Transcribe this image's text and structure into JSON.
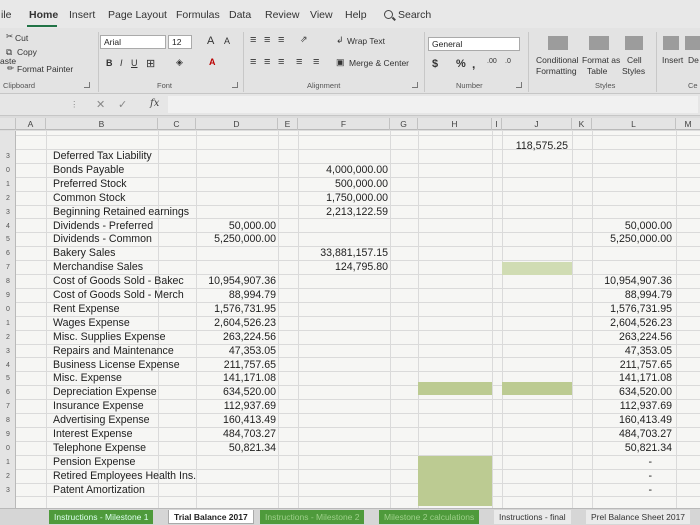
{
  "tabs": [
    "ile",
    "Home",
    "Insert",
    "Page Layout",
    "Formulas",
    "Data",
    "Review",
    "View",
    "Help",
    "Search"
  ],
  "ribbon": {
    "clipboard": {
      "cut": "Cut",
      "copy": "Copy",
      "format_painter": "Format Painter",
      "paste_fragment": "aste",
      "label": "Clipboard"
    },
    "font": {
      "name": "Arial",
      "size": "12",
      "grow": "A",
      "shrink": "A",
      "bold": "B",
      "italic": "I",
      "underline": "U",
      "label": "Font"
    },
    "alignment": {
      "wrap": "Wrap Text",
      "merge": "Merge & Center",
      "label": "Alignment"
    },
    "number": {
      "format": "General",
      "currency": "$",
      "percent": "%",
      "comma": ",",
      "label": "Number"
    },
    "styles": {
      "conditional": "Conditional",
      "formatting": "Formatting",
      "format_as": "Format as",
      "table": "Table",
      "cell": "Cell",
      "styles": "Styles",
      "label": "Styles"
    },
    "insert": "Insert",
    "delete_fragment": "De",
    "cells_fragment": "Ce"
  },
  "formula_bar": {
    "fx": "fx",
    "value": ""
  },
  "columns": [
    "A",
    "B",
    "C",
    "D",
    "E",
    "F",
    "G",
    "H",
    "I",
    "J",
    "K",
    "L",
    "M"
  ],
  "row_numbers": [
    "",
    "",
    "",
    "",
    "",
    "",
    "",
    "",
    "",
    "",
    "",
    "",
    "",
    "",
    "",
    "",
    "",
    "",
    "",
    "",
    "",
    "",
    "",
    "",
    "",
    "",
    ""
  ],
  "row_numbers_visible": [
    "3",
    "0",
    "1",
    "2",
    "3",
    "4",
    "5",
    "6",
    "7",
    "8",
    "9",
    "0",
    "1",
    "2",
    "3",
    "4",
    "5",
    "6",
    "7",
    "8",
    "9",
    "0",
    "1",
    "2",
    "3"
  ],
  "accounts": [
    "Deferred Tax Liability",
    "Bonds Payable",
    "Preferred Stock",
    "Common Stock",
    "Beginning Retained earnings",
    "Dividends - Preferred",
    "Dividends - Common",
    "Bakery Sales",
    "Merchandise Sales",
    "Cost of Goods Sold - Bakec",
    "Cost of Goods Sold - Merch",
    "Rent Expense",
    "Wages Expense",
    "Misc. Supplies Expense",
    "Repairs and Maintenance",
    "Business License Expense",
    "Misc. Expense",
    "Depreciation Expense",
    "Insurance Expense",
    "Advertising Expense",
    "Interest Expense",
    "Telephone Expense",
    "Pension Expense",
    "Retired Employees Health Ins.",
    "Patent Amortization"
  ],
  "col_d": [
    "",
    "",
    "",
    "",
    "",
    "50,000.00",
    "5,250,000.00",
    "",
    "",
    "10,954,907.36",
    "88,994.79",
    "1,576,731.95",
    "2,604,526.23",
    "263,224.56",
    "47,353.05",
    "211,757.65",
    "141,171.08",
    "634,520.00",
    "112,937.69",
    "160,413.49",
    "484,703.27",
    "50,821.34",
    "",
    "",
    ""
  ],
  "col_f": [
    "",
    "4,000,000.00",
    "500,000.00",
    "1,750,000.00",
    "2,213,122.59",
    "",
    "",
    "33,881,157.15",
    "124,795.80",
    "",
    "",
    "",
    "",
    "",
    "",
    "",
    "",
    "",
    "",
    "",
    "",
    "",
    "",
    "",
    ""
  ],
  "col_j": [
    "118,575.25"
  ],
  "col_l": [
    "",
    "",
    "",
    "",
    "",
    "50,000.00",
    "5,250,000.00",
    "",
    "",
    "10,954,907.36",
    "88,994.79",
    "1,576,731.95",
    "2,604,526.23",
    "263,224.56",
    "47,353.05",
    "211,757.65",
    "141,171.08",
    "634,520.00",
    "112,937.69",
    "160,413.49",
    "484,703.27",
    "50,821.34",
    "-",
    "-",
    "-"
  ],
  "sheet_tabs": [
    "Instructions - Milestone 1",
    "Trial Balance 2017",
    "Instructions - Milestone 2",
    "Milestone 2 calculations",
    "Instructions - final",
    "Prel Balance Sheet 2017"
  ],
  "colors": {
    "excel_green": "#217346",
    "highlight": "#c6d6a2",
    "tab_green": "#4e9a3b"
  }
}
